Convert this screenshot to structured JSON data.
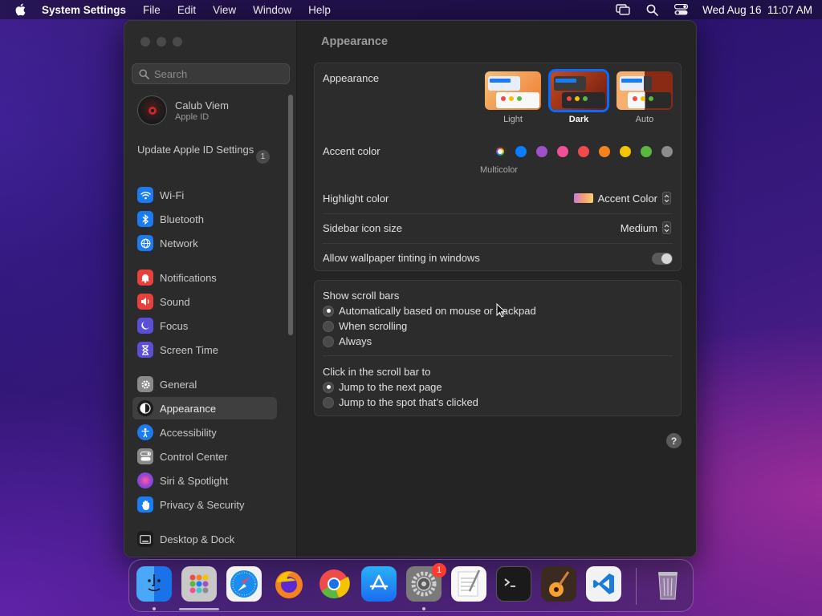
{
  "menubar": {
    "app_name": "System Settings",
    "menus": [
      "File",
      "Edit",
      "View",
      "Window",
      "Help"
    ],
    "clock": "Wed Aug 16  11:07 AM"
  },
  "sidebar": {
    "search_placeholder": "Search",
    "user_name": "Calub Viem",
    "user_sub": "Apple ID",
    "update_label": "Update Apple ID Settings",
    "update_badge": "1",
    "items": [
      {
        "label": "Wi-Fi",
        "icon": "wifi-icon",
        "color": "#1a7cf0"
      },
      {
        "label": "Bluetooth",
        "icon": "bluetooth-icon",
        "color": "#1a7cf0"
      },
      {
        "label": "Network",
        "icon": "globe-icon",
        "color": "#1a7cf0"
      },
      {
        "label": "Notifications",
        "icon": "bell-icon",
        "color": "#e8403a"
      },
      {
        "label": "Sound",
        "icon": "speaker-icon",
        "color": "#e8403a"
      },
      {
        "label": "Focus",
        "icon": "moon-icon",
        "color": "#5b4fd6"
      },
      {
        "label": "Screen Time",
        "icon": "hourglass-icon",
        "color": "#5b4fd6"
      },
      {
        "label": "General",
        "icon": "gear-icon",
        "color": "#8a8a8a"
      },
      {
        "label": "Appearance",
        "icon": "appearance-icon",
        "color": "#1c1c1c"
      },
      {
        "label": "Accessibility",
        "icon": "accessibility-icon",
        "color": "#1a7cf0"
      },
      {
        "label": "Control Center",
        "icon": "control-center-icon",
        "color": "#8a8a8a"
      },
      {
        "label": "Siri & Spotlight",
        "icon": "siri-icon",
        "color": "#a040d0"
      },
      {
        "label": "Privacy & Security",
        "icon": "hand-icon",
        "color": "#1a7cf0"
      },
      {
        "label": "Desktop & Dock",
        "icon": "desktop-icon",
        "color": "#1c1c1c"
      }
    ]
  },
  "main": {
    "title": "Appearance",
    "appearance_label": "Appearance",
    "themes": [
      {
        "label": "Light",
        "selected": false
      },
      {
        "label": "Dark",
        "selected": true
      },
      {
        "label": "Auto",
        "selected": false
      }
    ],
    "accent_label": "Accent color",
    "accent_caption": "Multicolor",
    "accent_colors": [
      "#0a7cff",
      "#a050c8",
      "#f0509a",
      "#f04b4b",
      "#f5821f",
      "#f5c400",
      "#5ab840",
      "#8c8c8c"
    ],
    "highlight_label": "Highlight color",
    "highlight_value": "Accent Color",
    "icon_size_label": "Sidebar icon size",
    "icon_size_value": "Medium",
    "tinting_label": "Allow wallpaper tinting in windows",
    "tinting_on": false,
    "scroll_label": "Show scroll bars",
    "scroll_options": [
      {
        "label": "Automatically based on mouse or trackpad",
        "selected": true
      },
      {
        "label": "When scrolling",
        "selected": false
      },
      {
        "label": "Always",
        "selected": false
      }
    ],
    "click_label": "Click in the scroll bar to",
    "click_options": [
      {
        "label": "Jump to the next page",
        "selected": true
      },
      {
        "label": "Jump to the spot that’s clicked",
        "selected": false
      }
    ],
    "help": "?"
  },
  "dock": {
    "apps": [
      "finder-icon",
      "launchpad-icon",
      "safari-icon",
      "firefox-icon",
      "chrome-icon",
      "app-store-icon",
      "system-settings-icon",
      "textedit-icon",
      "terminal-icon",
      "garageband-icon",
      "vscode-icon",
      "trash-icon"
    ],
    "settings_badge": "1"
  }
}
